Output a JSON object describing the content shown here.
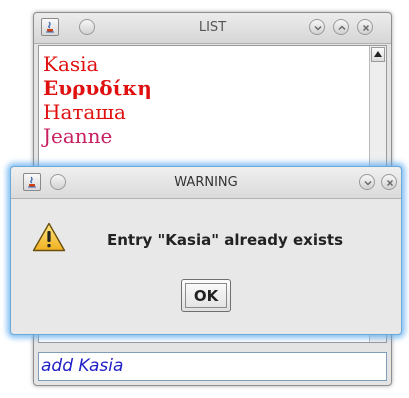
{
  "list_window": {
    "title": "LIST",
    "items": [
      {
        "label": "Kasia",
        "color": "#e01010",
        "bold": false
      },
      {
        "label": "Ευρυδίκη",
        "color": "#e01010",
        "bold": true
      },
      {
        "label": "Наташа",
        "color": "#e01010",
        "bold": false
      },
      {
        "label": "Jeanne",
        "color": "#c82060",
        "bold": false
      }
    ],
    "input_value": "add Kasia"
  },
  "warning_dialog": {
    "title": "WARNING",
    "message": "Entry \"Kasia\" already exists",
    "ok_label": "OK",
    "icon": "warning-triangle-icon"
  },
  "colors": {
    "dialog_glow": "#5aaaf0",
    "input_text": "#2020c8",
    "list_text": "#e01010"
  }
}
